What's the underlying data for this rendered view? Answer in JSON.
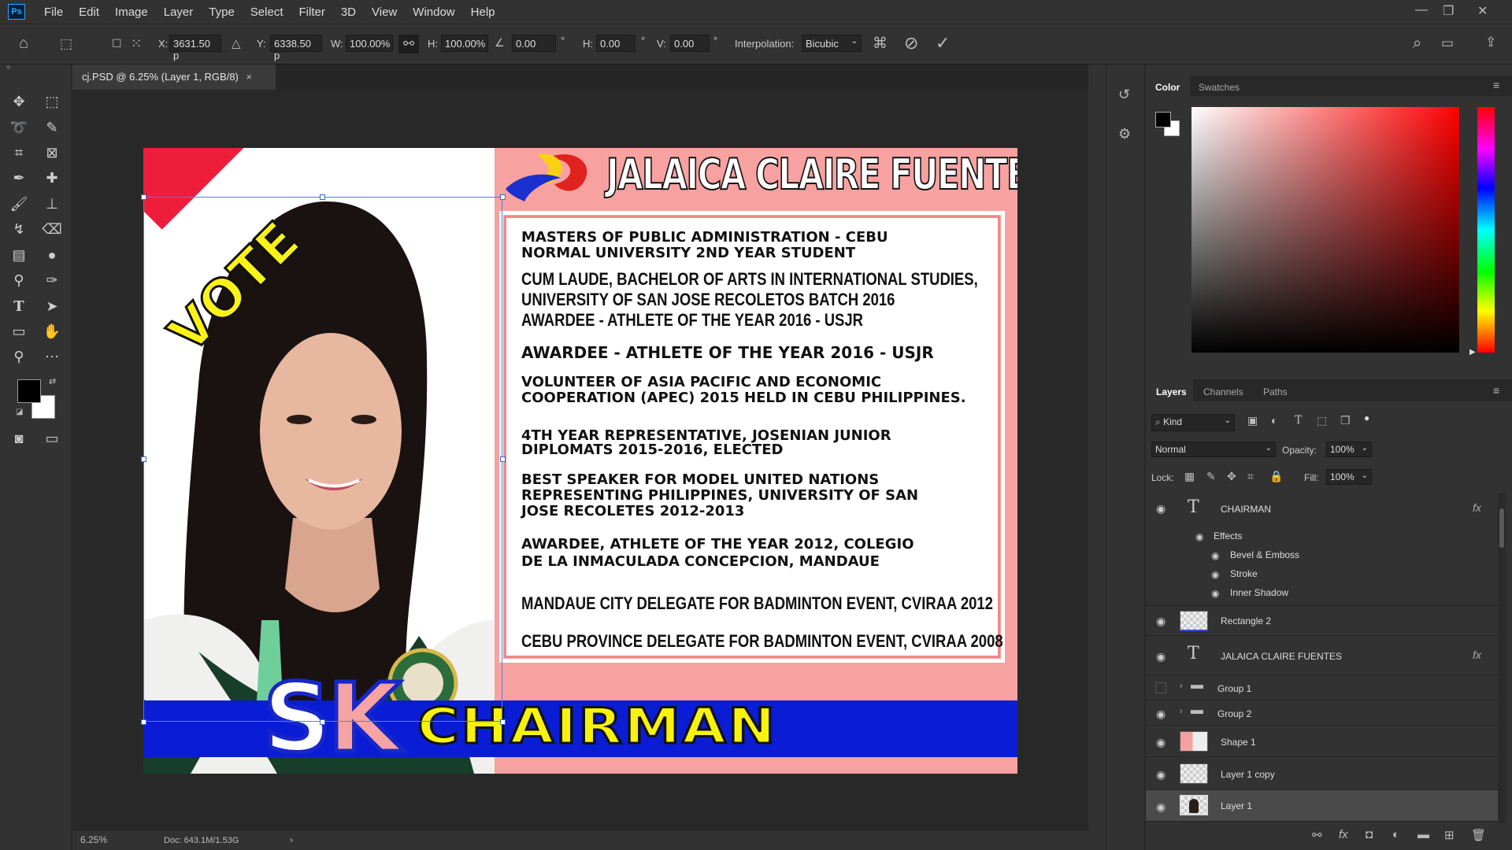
{
  "app": {
    "logo": "Ps",
    "menu": [
      "File",
      "Edit",
      "Image",
      "Layer",
      "Type",
      "Select",
      "Filter",
      "3D",
      "View",
      "Window",
      "Help"
    ]
  },
  "options": {
    "x_label": "X:",
    "x_value": "3631.50 p",
    "y_label": "Y:",
    "y_value": "6338.50 p",
    "w_label": "W:",
    "w_value": "100.00%",
    "h_label": "H:",
    "h_value": "100.00%",
    "angle_value": "0.00",
    "angle_unit": "°",
    "hskew_label": "H:",
    "hskew_value": "0.00",
    "hskew_unit": "°",
    "vskew_label": "V:",
    "vskew_value": "0.00",
    "vskew_unit": "°",
    "interp_label": "Interpolation:",
    "interp_value": "Bicubic"
  },
  "document": {
    "tab_title": "cj.PSD @ 6.25% (Layer 1, RGB/8)",
    "tab_close": "×",
    "zoom": "6.25%",
    "doc_info": "Doc: 643.1M/1.53G",
    "status_arrow": "›"
  },
  "poster": {
    "vote": "VOTE",
    "name": "JALAICA CLAIRE FUENTES",
    "sk_s": "S",
    "sk_k": "K",
    "chairman": "CHAIRMAN",
    "lines": [
      "MASTERS OF PUBLIC ADMINISTRATION - CEBU",
      "NORMAL UNIVERSITY 2ND YEAR STUDENT",
      "CUM LAUDE, BACHELOR OF ARTS IN INTERNATIONAL STUDIES,",
      "UNIVERSITY OF SAN JOSE RECOLETOS BATCH 2016",
      "AWARDEE - ATHLETE OF THE YEAR 2016 - USJR",
      "AWARDEE - ATHLETE OF THE YEAR 2016 - USJR",
      "VOLUNTEER OF ASIA PACIFIC AND ECONOMIC",
      "COOPERATION (APEC) 2015 HELD IN CEBU PHILIPPINES.",
      "4TH YEAR REPRESENTATIVE, JOSENIAN JUNIOR",
      "DIPLOMATS 2015-2016, ELECTED",
      "BEST SPEAKER FOR MODEL UNITED NATIONS",
      "REPRESENTING PHILIPPINES, UNIVERSITY OF SAN",
      "JOSE RECOLETES 2012-2013",
      "AWARDEE, ATHLETE OF THE YEAR 2012, COLEGIO",
      "DE LA INMACULADA CONCEPCION, MANDAUE",
      "MANDAUE CITY DELEGATE FOR BADMINTON EVENT, CVIRAA 2012",
      "CEBU PROVINCE DELEGATE FOR BADMINTON EVENT, CVIRAA 2008"
    ]
  },
  "color_panel": {
    "tabs": [
      "Color",
      "Swatches"
    ]
  },
  "layers_panel": {
    "tabs": [
      "Layers",
      "Channels",
      "Paths"
    ],
    "kind": "Kind",
    "blend": "Normal",
    "opacity_label": "Opacity:",
    "opacity": "100%",
    "lock_label": "Lock:",
    "fill_label": "Fill:",
    "fill": "100%",
    "effects_label": "Effects",
    "effects": [
      "Bevel & Emboss",
      "Stroke",
      "Inner Shadow"
    ],
    "fx": "fx",
    "layers": [
      {
        "name": "CHAIRMAN"
      },
      {
        "name": "Rectangle 2"
      },
      {
        "name": "JALAICA CLAIRE FUENTES"
      },
      {
        "name": "Group 1"
      },
      {
        "name": "Group 2"
      },
      {
        "name": "Shape 1"
      },
      {
        "name": "Layer 1 copy"
      },
      {
        "name": "Layer 1"
      }
    ]
  },
  "colors": {
    "poster_pink": "#f7a1a1",
    "vote_red": "#ee1d3b",
    "vote_yellow": "#fbf21a",
    "bar_blue": "#0a1dd4",
    "chairman_yellow": "#f7f20d",
    "picker_hue": "#ff0000"
  }
}
